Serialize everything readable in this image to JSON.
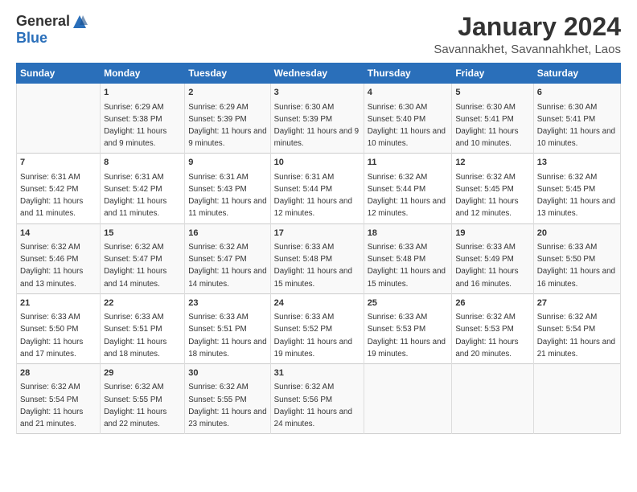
{
  "logo": {
    "general": "General",
    "blue": "Blue"
  },
  "title": "January 2024",
  "subtitle": "Savannakhet, Savannahkhet, Laos",
  "days_of_week": [
    "Sunday",
    "Monday",
    "Tuesday",
    "Wednesday",
    "Thursday",
    "Friday",
    "Saturday"
  ],
  "weeks": [
    [
      {
        "day": "",
        "sunrise": "",
        "sunset": "",
        "daylight": ""
      },
      {
        "day": "1",
        "sunrise": "Sunrise: 6:29 AM",
        "sunset": "Sunset: 5:38 PM",
        "daylight": "Daylight: 11 hours and 9 minutes."
      },
      {
        "day": "2",
        "sunrise": "Sunrise: 6:29 AM",
        "sunset": "Sunset: 5:39 PM",
        "daylight": "Daylight: 11 hours and 9 minutes."
      },
      {
        "day": "3",
        "sunrise": "Sunrise: 6:30 AM",
        "sunset": "Sunset: 5:39 PM",
        "daylight": "Daylight: 11 hours and 9 minutes."
      },
      {
        "day": "4",
        "sunrise": "Sunrise: 6:30 AM",
        "sunset": "Sunset: 5:40 PM",
        "daylight": "Daylight: 11 hours and 10 minutes."
      },
      {
        "day": "5",
        "sunrise": "Sunrise: 6:30 AM",
        "sunset": "Sunset: 5:41 PM",
        "daylight": "Daylight: 11 hours and 10 minutes."
      },
      {
        "day": "6",
        "sunrise": "Sunrise: 6:30 AM",
        "sunset": "Sunset: 5:41 PM",
        "daylight": "Daylight: 11 hours and 10 minutes."
      }
    ],
    [
      {
        "day": "7",
        "sunrise": "Sunrise: 6:31 AM",
        "sunset": "Sunset: 5:42 PM",
        "daylight": "Daylight: 11 hours and 11 minutes."
      },
      {
        "day": "8",
        "sunrise": "Sunrise: 6:31 AM",
        "sunset": "Sunset: 5:42 PM",
        "daylight": "Daylight: 11 hours and 11 minutes."
      },
      {
        "day": "9",
        "sunrise": "Sunrise: 6:31 AM",
        "sunset": "Sunset: 5:43 PM",
        "daylight": "Daylight: 11 hours and 11 minutes."
      },
      {
        "day": "10",
        "sunrise": "Sunrise: 6:31 AM",
        "sunset": "Sunset: 5:44 PM",
        "daylight": "Daylight: 11 hours and 12 minutes."
      },
      {
        "day": "11",
        "sunrise": "Sunrise: 6:32 AM",
        "sunset": "Sunset: 5:44 PM",
        "daylight": "Daylight: 11 hours and 12 minutes."
      },
      {
        "day": "12",
        "sunrise": "Sunrise: 6:32 AM",
        "sunset": "Sunset: 5:45 PM",
        "daylight": "Daylight: 11 hours and 12 minutes."
      },
      {
        "day": "13",
        "sunrise": "Sunrise: 6:32 AM",
        "sunset": "Sunset: 5:45 PM",
        "daylight": "Daylight: 11 hours and 13 minutes."
      }
    ],
    [
      {
        "day": "14",
        "sunrise": "Sunrise: 6:32 AM",
        "sunset": "Sunset: 5:46 PM",
        "daylight": "Daylight: 11 hours and 13 minutes."
      },
      {
        "day": "15",
        "sunrise": "Sunrise: 6:32 AM",
        "sunset": "Sunset: 5:47 PM",
        "daylight": "Daylight: 11 hours and 14 minutes."
      },
      {
        "day": "16",
        "sunrise": "Sunrise: 6:32 AM",
        "sunset": "Sunset: 5:47 PM",
        "daylight": "Daylight: 11 hours and 14 minutes."
      },
      {
        "day": "17",
        "sunrise": "Sunrise: 6:33 AM",
        "sunset": "Sunset: 5:48 PM",
        "daylight": "Daylight: 11 hours and 15 minutes."
      },
      {
        "day": "18",
        "sunrise": "Sunrise: 6:33 AM",
        "sunset": "Sunset: 5:48 PM",
        "daylight": "Daylight: 11 hours and 15 minutes."
      },
      {
        "day": "19",
        "sunrise": "Sunrise: 6:33 AM",
        "sunset": "Sunset: 5:49 PM",
        "daylight": "Daylight: 11 hours and 16 minutes."
      },
      {
        "day": "20",
        "sunrise": "Sunrise: 6:33 AM",
        "sunset": "Sunset: 5:50 PM",
        "daylight": "Daylight: 11 hours and 16 minutes."
      }
    ],
    [
      {
        "day": "21",
        "sunrise": "Sunrise: 6:33 AM",
        "sunset": "Sunset: 5:50 PM",
        "daylight": "Daylight: 11 hours and 17 minutes."
      },
      {
        "day": "22",
        "sunrise": "Sunrise: 6:33 AM",
        "sunset": "Sunset: 5:51 PM",
        "daylight": "Daylight: 11 hours and 18 minutes."
      },
      {
        "day": "23",
        "sunrise": "Sunrise: 6:33 AM",
        "sunset": "Sunset: 5:51 PM",
        "daylight": "Daylight: 11 hours and 18 minutes."
      },
      {
        "day": "24",
        "sunrise": "Sunrise: 6:33 AM",
        "sunset": "Sunset: 5:52 PM",
        "daylight": "Daylight: 11 hours and 19 minutes."
      },
      {
        "day": "25",
        "sunrise": "Sunrise: 6:33 AM",
        "sunset": "Sunset: 5:53 PM",
        "daylight": "Daylight: 11 hours and 19 minutes."
      },
      {
        "day": "26",
        "sunrise": "Sunrise: 6:32 AM",
        "sunset": "Sunset: 5:53 PM",
        "daylight": "Daylight: 11 hours and 20 minutes."
      },
      {
        "day": "27",
        "sunrise": "Sunrise: 6:32 AM",
        "sunset": "Sunset: 5:54 PM",
        "daylight": "Daylight: 11 hours and 21 minutes."
      }
    ],
    [
      {
        "day": "28",
        "sunrise": "Sunrise: 6:32 AM",
        "sunset": "Sunset: 5:54 PM",
        "daylight": "Daylight: 11 hours and 21 minutes."
      },
      {
        "day": "29",
        "sunrise": "Sunrise: 6:32 AM",
        "sunset": "Sunset: 5:55 PM",
        "daylight": "Daylight: 11 hours and 22 minutes."
      },
      {
        "day": "30",
        "sunrise": "Sunrise: 6:32 AM",
        "sunset": "Sunset: 5:55 PM",
        "daylight": "Daylight: 11 hours and 23 minutes."
      },
      {
        "day": "31",
        "sunrise": "Sunrise: 6:32 AM",
        "sunset": "Sunset: 5:56 PM",
        "daylight": "Daylight: 11 hours and 24 minutes."
      },
      {
        "day": "",
        "sunrise": "",
        "sunset": "",
        "daylight": ""
      },
      {
        "day": "",
        "sunrise": "",
        "sunset": "",
        "daylight": ""
      },
      {
        "day": "",
        "sunrise": "",
        "sunset": "",
        "daylight": ""
      }
    ]
  ]
}
